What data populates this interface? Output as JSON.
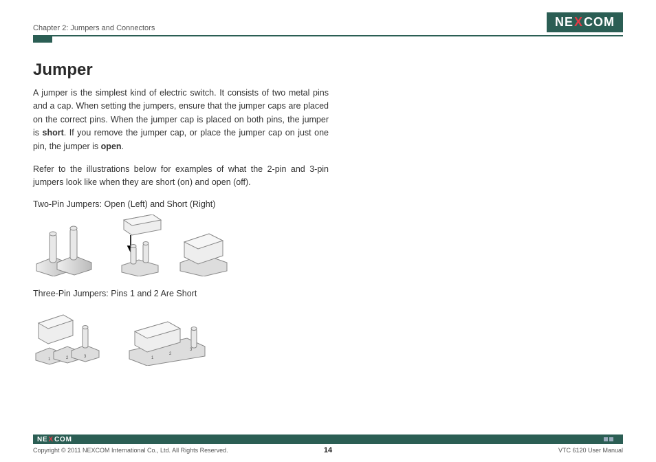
{
  "header": {
    "chapter": "Chapter 2: Jumpers and Connectors",
    "brand_left": "NE",
    "brand_x": "X",
    "brand_right": "COM"
  },
  "section": {
    "title": "Jumper",
    "p1a": "A jumper is the simplest kind of electric switch. It consists of two metal pins and a cap. When setting the jumpers, ensure that the jumper caps are placed on the correct pins. When the jumper cap is placed on both pins, the jumper is ",
    "p1b": "short",
    "p1c": ". If you remove the jumper cap, or place the jumper cap on just one pin, the jumper is ",
    "p1d": "open",
    "p1e": ".",
    "p2": "Refer to the illustrations below for examples of what the 2-pin and 3-pin jumpers look like when they are short (on) and open (off).",
    "cap1": "Two-Pin Jumpers: Open (Left) and Short (Right)",
    "cap2": "Three-Pin Jumpers: Pins 1 and 2 Are Short"
  },
  "footer": {
    "copyright": "Copyright © 2011 NEXCOM International Co., Ltd. All Rights Reserved.",
    "page": "14",
    "manual": "VTC 6120 User Manual"
  }
}
